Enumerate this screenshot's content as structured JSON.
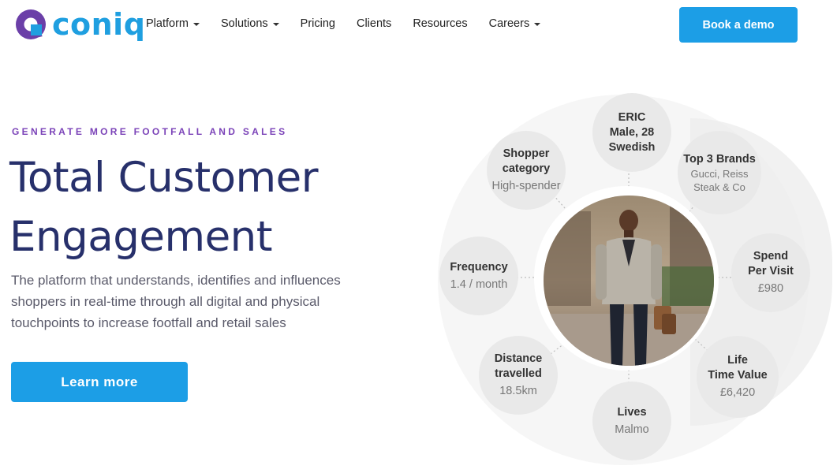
{
  "nav": {
    "brand": "coniq",
    "items": [
      {
        "label": "Platform",
        "dropdown": true
      },
      {
        "label": "Solutions",
        "dropdown": true
      },
      {
        "label": "Pricing",
        "dropdown": false
      },
      {
        "label": "Clients",
        "dropdown": false
      },
      {
        "label": "Resources",
        "dropdown": false
      },
      {
        "label": "Careers",
        "dropdown": true
      }
    ],
    "cta": "Book a demo"
  },
  "hero": {
    "eyebrow": "GENERATE MORE FOOTFALL AND SALES",
    "headline_line1": "Total Customer",
    "headline_line2": "Engagement",
    "subtext": "The platform that understands, identifies and influences shoppers in real-time through all digital and physical touchpoints to increase footfall and retail sales",
    "cta": "Learn more"
  },
  "profile": {
    "identity": {
      "line1": "ERIC",
      "line2": "Male, 28",
      "line3": "Swedish"
    },
    "shopper_category": {
      "title_line1": "Shopper",
      "title_line2": "category",
      "value": "High-spender"
    },
    "top_brands": {
      "title": "Top 3 Brands",
      "value_line1": "Gucci, Reiss",
      "value_line2": "Steak & Co"
    },
    "frequency": {
      "title": "Frequency",
      "value": "1.4 / month"
    },
    "spend_per_visit": {
      "title_line1": "Spend",
      "title_line2": "Per Visit",
      "value": "£980"
    },
    "distance": {
      "title_line1": "Distance",
      "title_line2": "travelled",
      "value": "18.5km"
    },
    "lives": {
      "title": "Lives",
      "value": "Malmo"
    },
    "lifetime_value": {
      "title_line1": "Life",
      "title_line2": "Time Value",
      "value": "£6,420"
    }
  },
  "colors": {
    "accent": "#1c9ee6",
    "brand_purple": "#6b3fa8",
    "headline": "#27306b",
    "eyebrow": "#7b43b8"
  }
}
